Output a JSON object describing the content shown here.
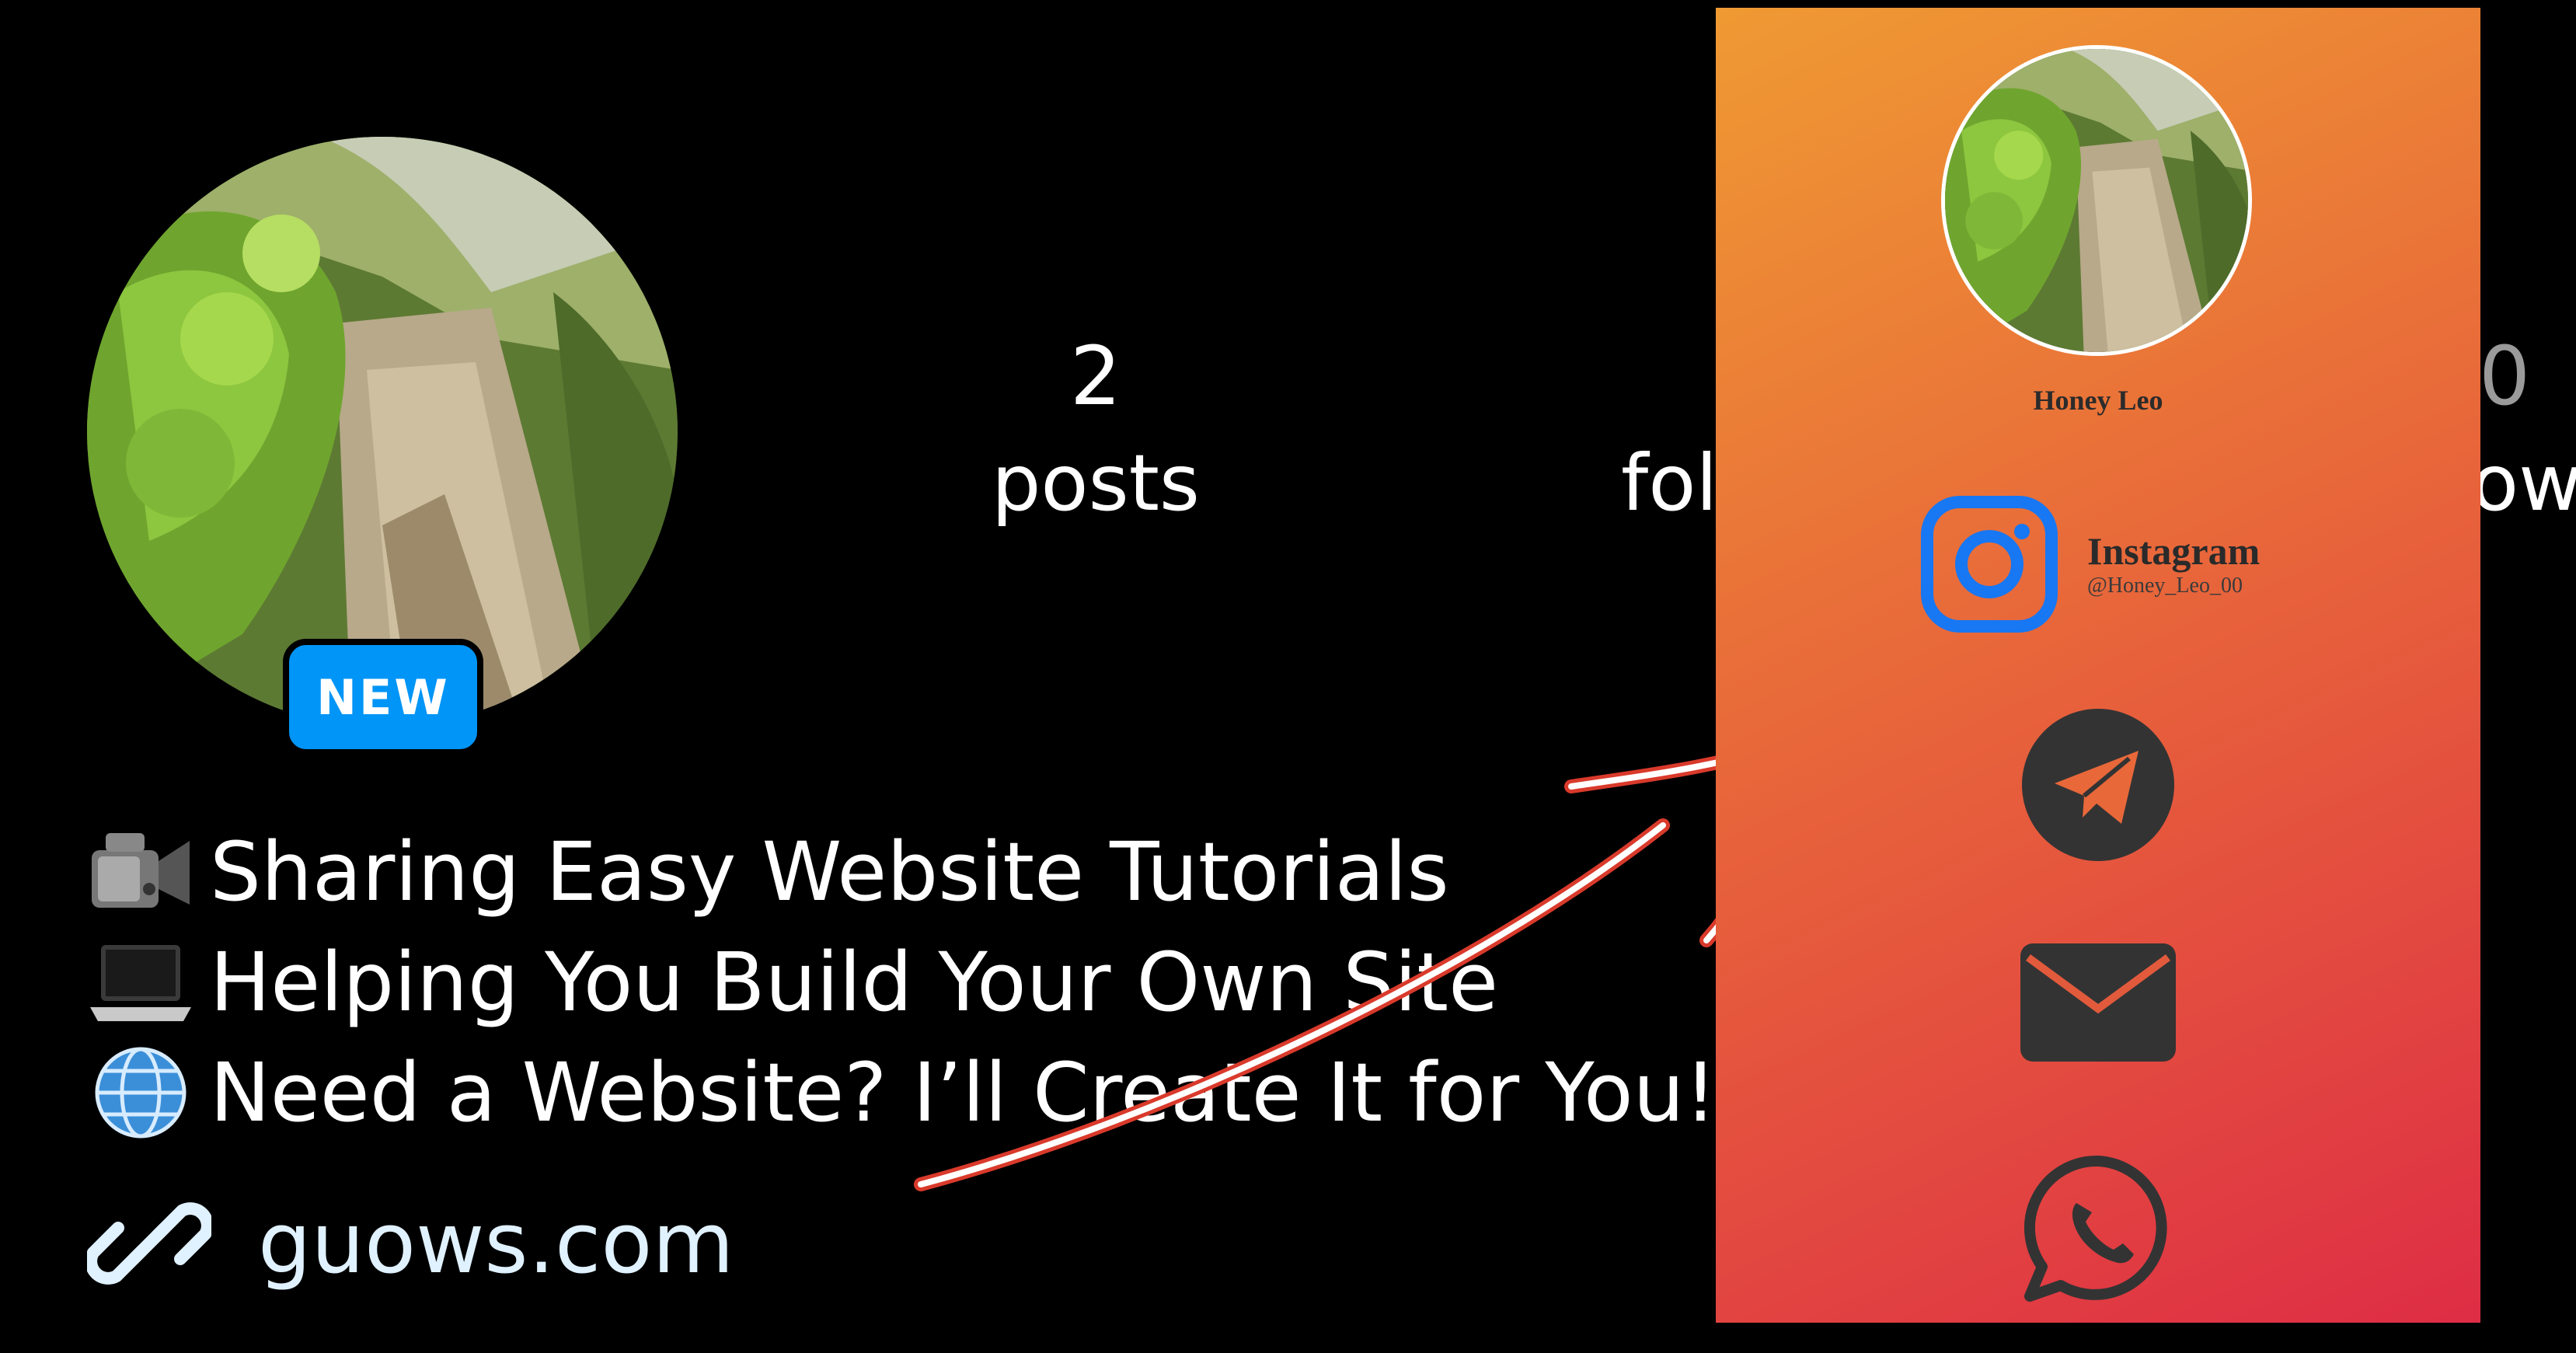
{
  "profile": {
    "badge": "NEW",
    "stats": [
      {
        "value": "2",
        "label": "posts"
      },
      {
        "label": "fol"
      },
      {
        "value_partial": "0",
        "label_partial": "owi"
      }
    ],
    "bio": [
      {
        "icon": "video-camera-icon",
        "text": "Sharing Easy Website Tutorials"
      },
      {
        "icon": "laptop-icon",
        "text": "Helping You Build Your Own Site"
      },
      {
        "icon": "globe-icon",
        "text": "Need a Website? I’ll Create It for You!"
      }
    ],
    "link": {
      "icon": "link-icon",
      "text": "guows.com"
    }
  },
  "card": {
    "name": "Honey Leo",
    "instagram": {
      "title": "Instagram",
      "handle": "@Honey_Leo_00",
      "icon": "instagram-icon"
    },
    "icons": [
      "telegram-icon",
      "email-icon",
      "whatsapp-icon"
    ]
  },
  "colors": {
    "background": "#000000",
    "badge": "#0095f6",
    "card_gradient_start": "#ef9a33",
    "card_gradient_end": "#de2d45",
    "instagram_blue": "#1877f2",
    "icon_dark": "#333333",
    "arrow": "#ffffff",
    "arrow_outline": "#d93a2b"
  }
}
